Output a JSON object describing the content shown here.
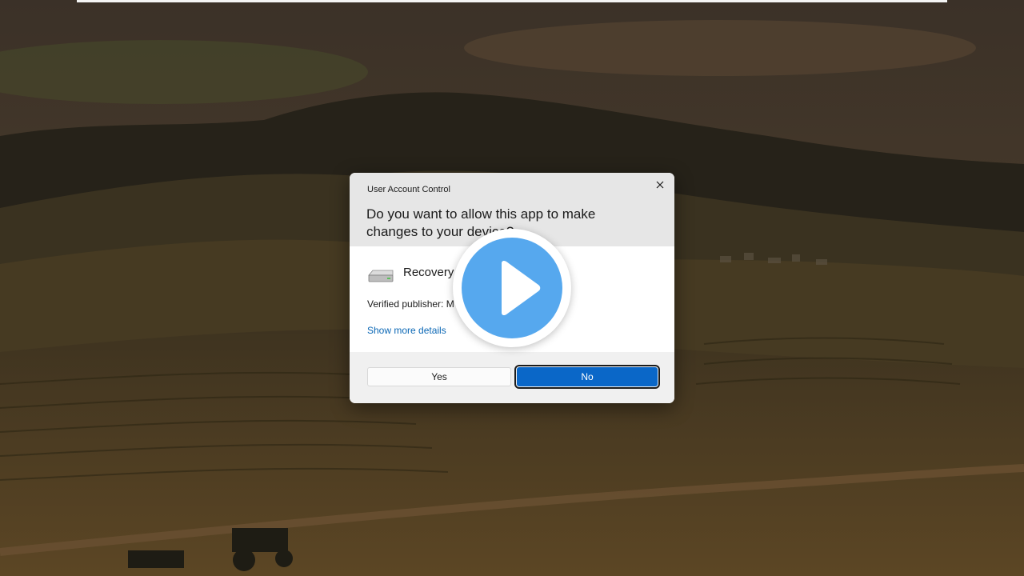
{
  "dialog": {
    "title": "User Account Control",
    "question": "Do you want to allow this app to make changes to your device?",
    "app_name": "Recovery",
    "publisher": "Verified publisher: M",
    "details_link": "Show more details",
    "yes_label": "Yes",
    "no_label": "No"
  },
  "icons": {
    "close": "close-icon",
    "app": "drive-icon",
    "play": "play-icon"
  },
  "colors": {
    "accent": "#0a67c8",
    "link": "#0a67b5",
    "play": "#56a8ee"
  }
}
